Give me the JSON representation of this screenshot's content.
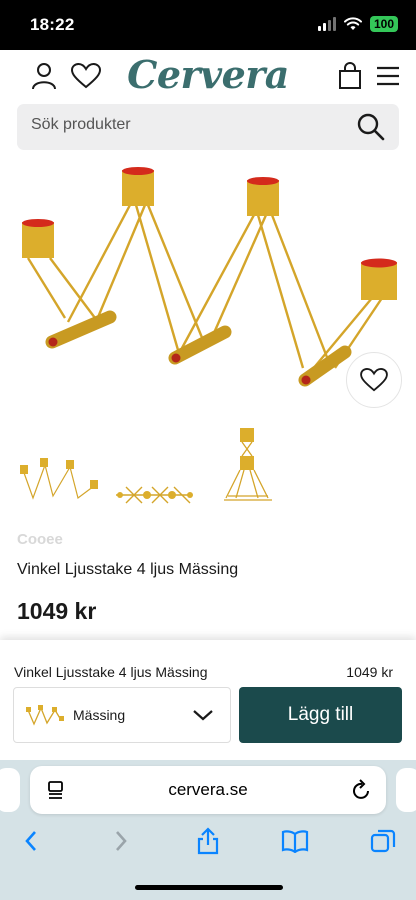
{
  "status_bar": {
    "time": "18:22",
    "battery": "100"
  },
  "header": {
    "logo": "Cervera",
    "icons": [
      "account-icon",
      "heart-icon",
      "bag-icon",
      "menu-icon"
    ]
  },
  "search": {
    "placeholder": "Sök produkter"
  },
  "product": {
    "brand": "Cooee",
    "title": "Vinkel Ljusstake 4 ljus Mässing",
    "price": "1049 kr"
  },
  "buy_panel": {
    "title": "Vinkel Ljusstake 4 ljus Mässing",
    "price": "1049 kr",
    "variant": "Mässing",
    "add_button": "Lägg till"
  },
  "browser": {
    "url": "cervera.se"
  },
  "colors": {
    "brand": "#3b6e6e",
    "button": "#1b4a4c",
    "brass": "#d4a52a",
    "candle_red": "#d42a1c"
  }
}
